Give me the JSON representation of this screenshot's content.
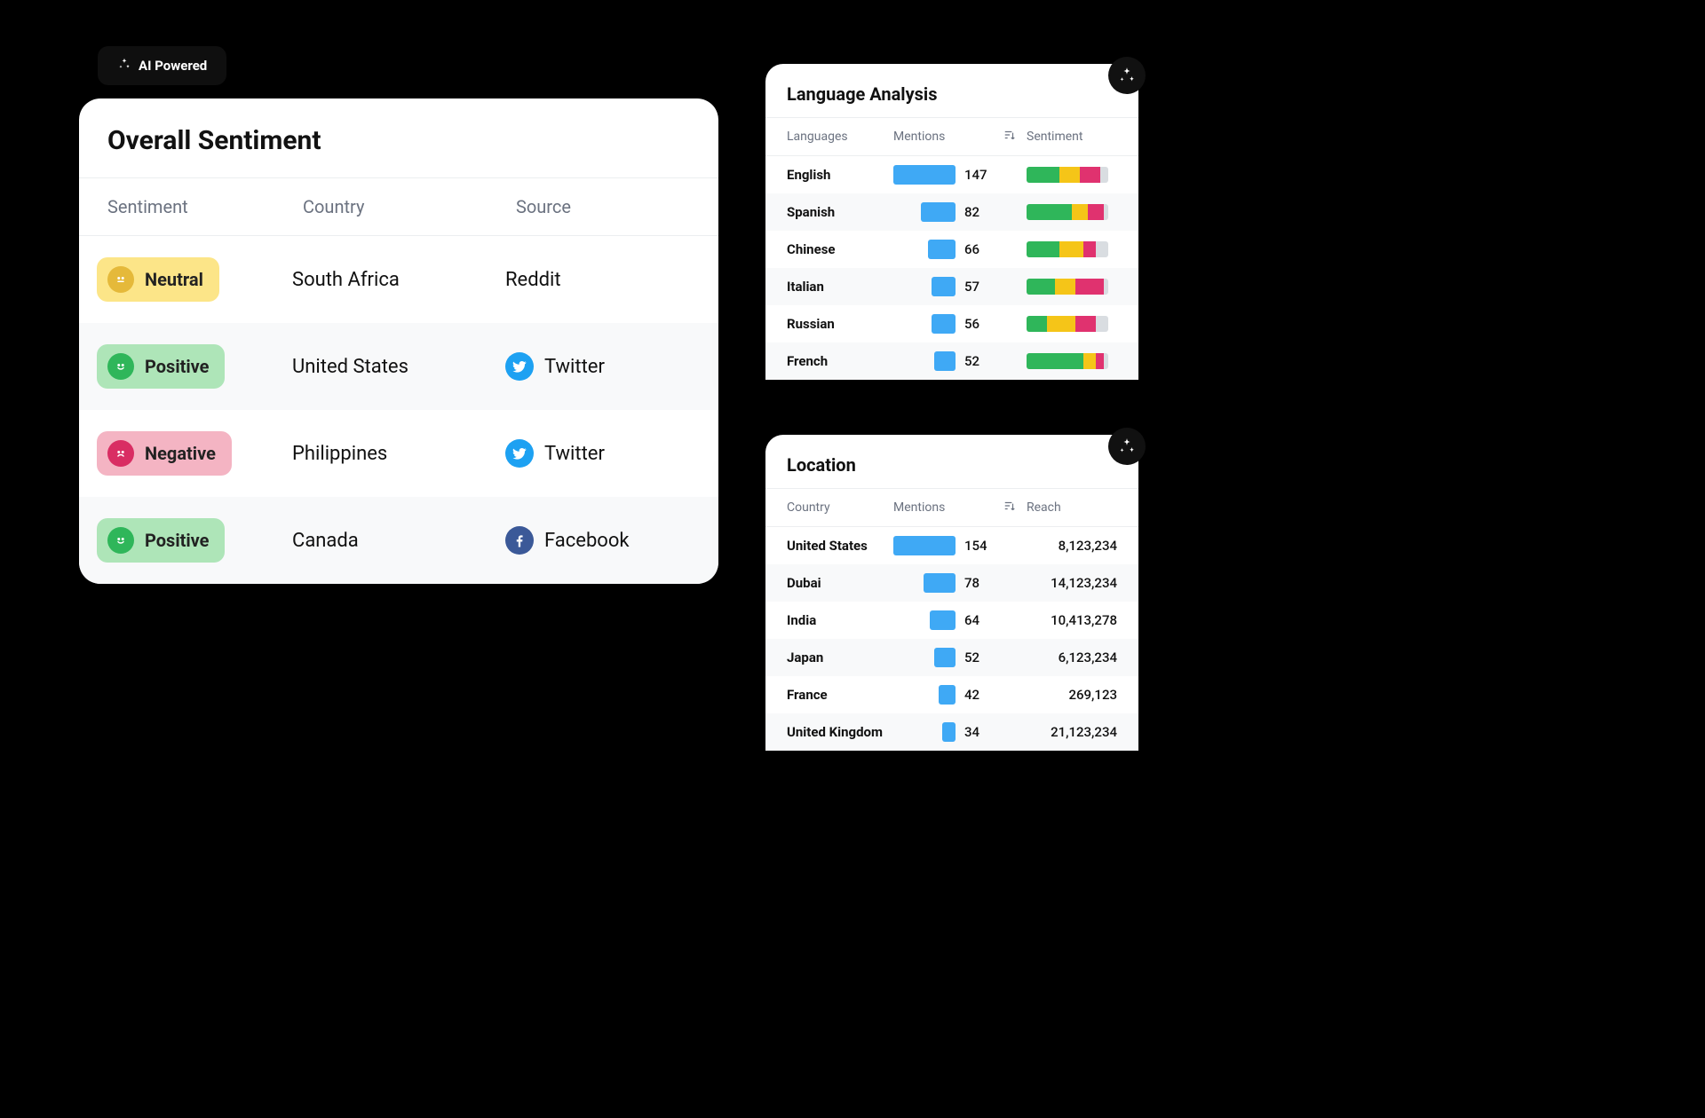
{
  "ai_badge": "AI Powered",
  "overall": {
    "title": "Overall Sentiment",
    "headers": {
      "sentiment": "Sentiment",
      "country": "Country",
      "source": "Source"
    },
    "rows": [
      {
        "sentiment": "Neutral",
        "sent_type": "neutral",
        "country": "South Africa",
        "source": "Reddit",
        "source_icon": ""
      },
      {
        "sentiment": "Positive",
        "sent_type": "positive",
        "country": "United States",
        "source": "Twitter",
        "source_icon": "twitter"
      },
      {
        "sentiment": "Negative",
        "sent_type": "negative",
        "country": "Philippines",
        "source": "Twitter",
        "source_icon": "twitter"
      },
      {
        "sentiment": "Positive",
        "sent_type": "positive",
        "country": "Canada",
        "source": "Facebook",
        "source_icon": "facebook"
      }
    ]
  },
  "language": {
    "title": "Language Analysis",
    "headers": {
      "lang": "Languages",
      "mentions": "Mentions",
      "sentiment": "Sentiment"
    },
    "rows": [
      {
        "name": "English",
        "mentions": 147,
        "bar": 100,
        "sent": [
          40,
          25,
          25,
          10
        ]
      },
      {
        "name": "Spanish",
        "mentions": 82,
        "bar": 56,
        "sent": [
          55,
          20,
          20,
          5
        ]
      },
      {
        "name": "Chinese",
        "mentions": 66,
        "bar": 45,
        "sent": [
          40,
          30,
          15,
          15
        ]
      },
      {
        "name": "Italian",
        "mentions": 57,
        "bar": 39,
        "sent": [
          35,
          25,
          35,
          5
        ]
      },
      {
        "name": "Russian",
        "mentions": 56,
        "bar": 38,
        "sent": [
          25,
          35,
          25,
          15
        ]
      },
      {
        "name": "French",
        "mentions": 52,
        "bar": 35,
        "sent": [
          70,
          15,
          10,
          5
        ]
      }
    ]
  },
  "location": {
    "title": "Location",
    "headers": {
      "country": "Country",
      "mentions": "Mentions",
      "reach": "Reach"
    },
    "rows": [
      {
        "name": "United States",
        "mentions": 154,
        "bar": 100,
        "reach": "8,123,234"
      },
      {
        "name": "Dubai",
        "mentions": 78,
        "bar": 51,
        "reach": "14,123,234"
      },
      {
        "name": "India",
        "mentions": 64,
        "bar": 42,
        "reach": "10,413,278"
      },
      {
        "name": "Japan",
        "mentions": 52,
        "bar": 34,
        "reach": "6,123,234"
      },
      {
        "name": "France",
        "mentions": 42,
        "bar": 27,
        "reach": "269,123"
      },
      {
        "name": "United Kingdom",
        "mentions": 34,
        "bar": 22,
        "reach": "21,123,234"
      }
    ]
  }
}
